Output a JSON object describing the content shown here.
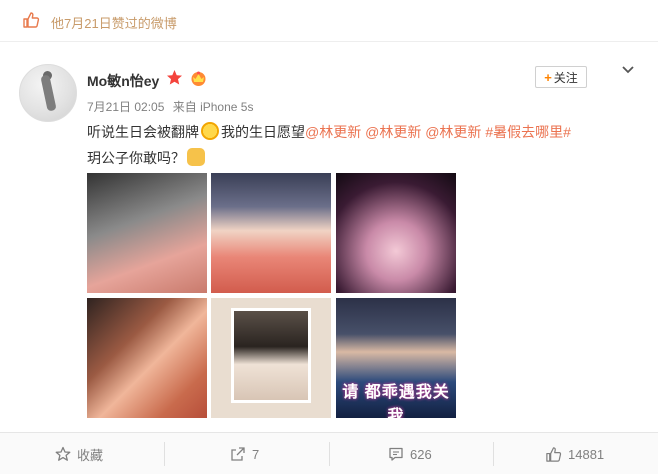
{
  "liked": {
    "text": "他7月21日赞过的微博"
  },
  "user": {
    "name": "Mo敏n怡ey"
  },
  "meta": {
    "time": "7月21日 02:05",
    "source": "来自 iPhone 5s"
  },
  "follow": {
    "plus": "+",
    "label": "关注"
  },
  "post": {
    "t1": "听说生日会被翻牌",
    "t2": "我的生日愿望",
    "m1": "@林更新",
    "m2": "@林更新",
    "m3": "@林更新",
    "hashtag": "#暑假去哪里#",
    "t3": "玥公子你敢吗？"
  },
  "photos": {
    "p6_caption": "请 都乖遇我关我"
  },
  "actions": {
    "favorite": "收藏",
    "repost": "7",
    "comment": "626",
    "like": "14881"
  },
  "colors": {
    "accent": "#ff8200",
    "link": "#eb7350",
    "muted": "#808080"
  }
}
